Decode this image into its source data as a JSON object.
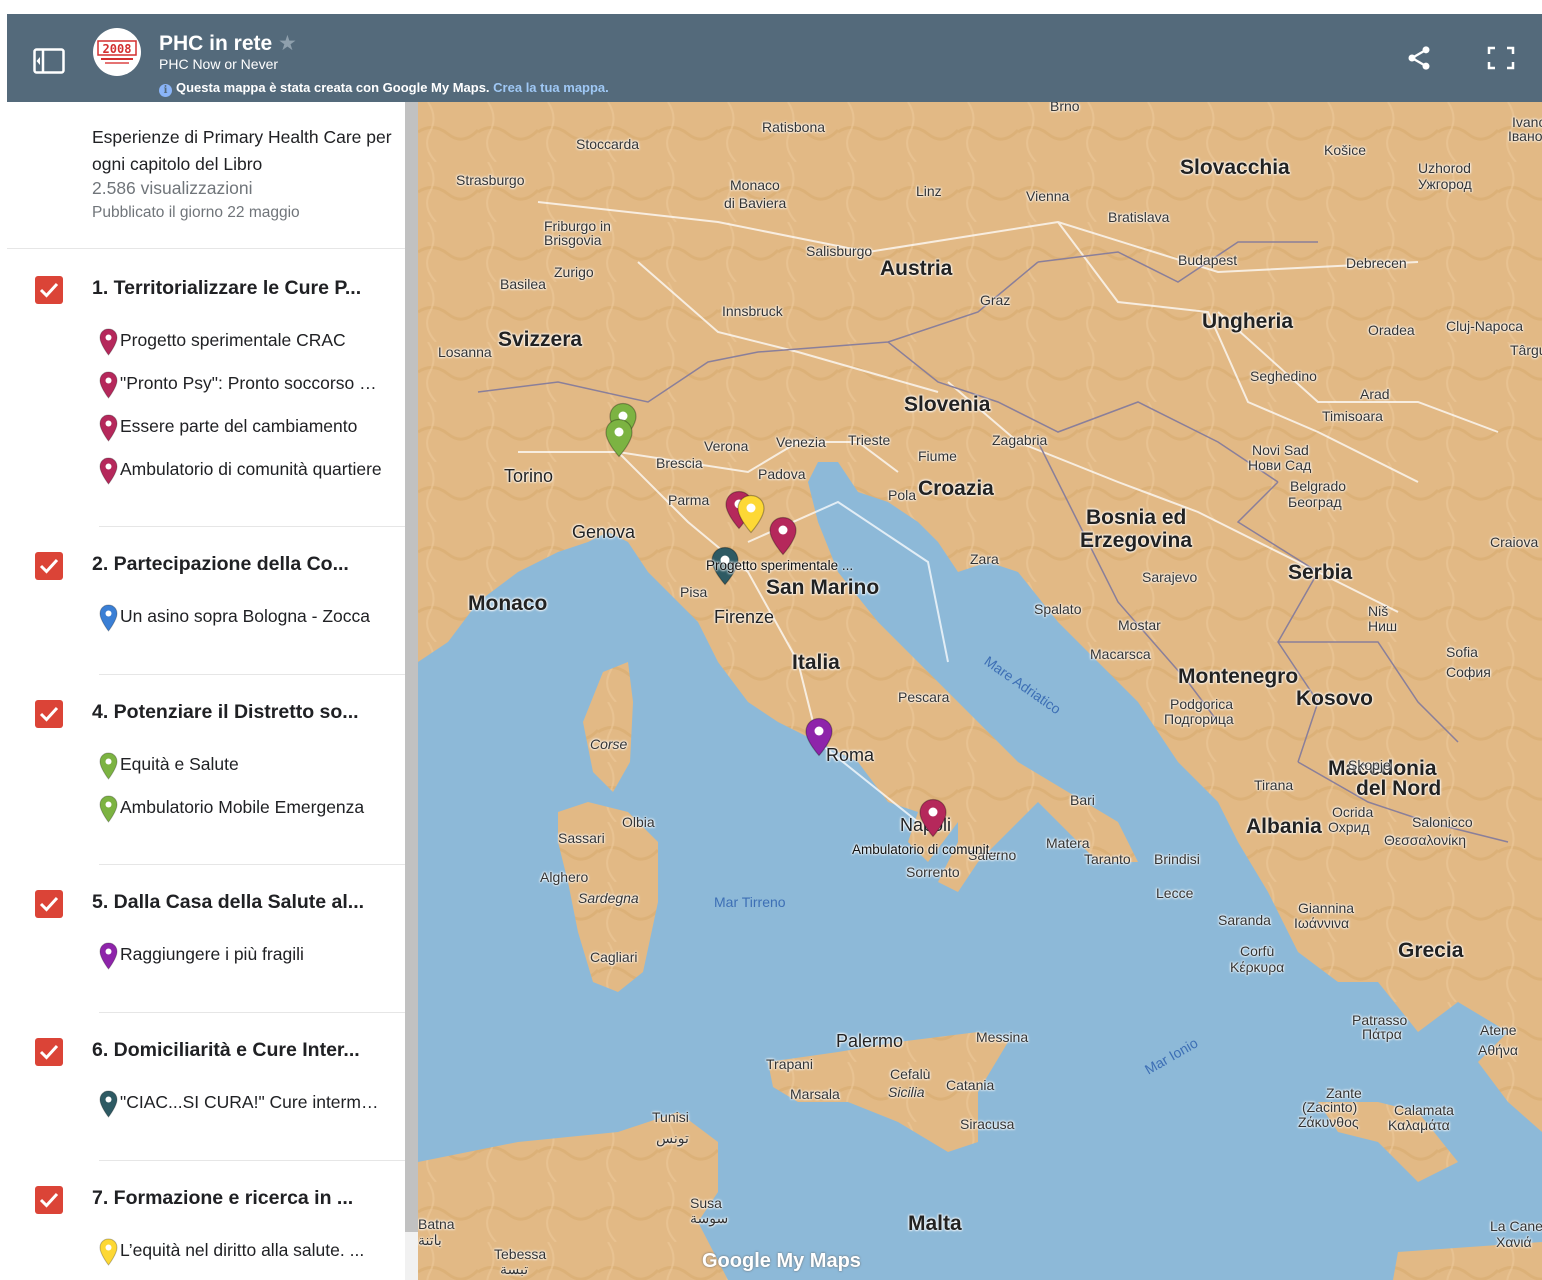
{
  "header": {
    "title": "PHC in rete",
    "subtitle": "PHC Now or Never",
    "notice_text": "Questa mappa è stata creata con Google My Maps.",
    "notice_link": "Crea la tua mappa.",
    "logo_text": "2008",
    "icons": [
      "side-panel-icon",
      "star-icon",
      "info-icon",
      "share-icon",
      "fullscreen-icon"
    ],
    "bar_color": "#546a7b"
  },
  "sidebar": {
    "description": "Esperienze di Primary Health Care per ogni capitolo del Libro",
    "views": "2.586 visualizzazioni",
    "published": "Pubblicato il giorno 22 maggio",
    "layers": [
      {
        "title": "1. Territorializzare le Cure P...",
        "checked": true,
        "places": [
          {
            "label": "Progetto sperimentale CRAC",
            "color": "#b5285b"
          },
          {
            "label": "\"Pronto Psy\": Pronto soccorso psicologico",
            "color": "#b5285b"
          },
          {
            "label": "Essere parte del cambiamento",
            "color": "#b5285b"
          },
          {
            "label": "Ambulatorio di comunità quartiere",
            "color": "#b5285b"
          }
        ]
      },
      {
        "title": "2. Partecipazione della Co...",
        "checked": true,
        "places": [
          {
            "label": "Un asino sopra Bologna - Zocca",
            "color": "#3a7fd5"
          }
        ]
      },
      {
        "title": "4. Potenziare il Distretto so...",
        "checked": true,
        "places": [
          {
            "label": "Equità e Salute",
            "color": "#7cb342"
          },
          {
            "label": "Ambulatorio Mobile Emergenza",
            "color": "#7cb342"
          }
        ]
      },
      {
        "title": "5. Dalla Casa della Salute al...",
        "checked": true,
        "places": [
          {
            "label": "Raggiungere i più fragili",
            "color": "#8e24aa"
          }
        ]
      },
      {
        "title": "6. Domiciliarità e Cure Inter...",
        "checked": true,
        "places": [
          {
            "label": "\"CIAC...SI CURA!\" Cure intermedie",
            "color": "#2e5a63"
          }
        ]
      },
      {
        "title": "7. Formazione e ricerca in ...",
        "checked": true,
        "places": [
          {
            "label": "L’equità nel diritto alla salute. ...",
            "color": "#fdd835"
          }
        ]
      }
    ]
  },
  "map": {
    "countries": [
      "Svizzera",
      "Austria",
      "Slovacchia",
      "Ungheria",
      "Slovenia",
      "Croazia",
      "Bosnia ed",
      "Erzegovina",
      "Serbia",
      "Italia",
      "San Marino",
      "Monaco",
      "Montenegro",
      "Kosovo",
      "Macedonia",
      "del Nord",
      "Albania",
      "Grecia",
      "Malta"
    ],
    "cities": [
      "Stoccarda",
      "Strasburgo",
      "Ratisbona",
      "Monaco",
      "di Baviera",
      "Linz",
      "Vienna",
      "Bratislava",
      "Brno",
      "Košice",
      "Uzhorod",
      "Ужгород",
      "Friburgo in",
      "Brisgovia",
      "Salisburgo",
      "Zurigo",
      "Basilea",
      "Budapest",
      "Debrecen",
      "Innsbruck",
      "Graz",
      "Losanna",
      "Oradea",
      "Cluj-Napoca",
      "Târgu",
      "Seghedino",
      "Arad",
      "Timisoara",
      "Verona",
      "Venezia",
      "Trieste",
      "Brescia",
      "Padova",
      "Fiume",
      "Zagabria",
      "Torino",
      "Pola",
      "Novi Sad",
      "Нови Сад",
      "Belgrado",
      "Београд",
      "Parma",
      "Genova",
      "Zara",
      "Sarajevo",
      "Craiova",
      "Pisa",
      "Firenze",
      "Spalato",
      "Mostar",
      "Niš",
      "Ниш",
      "Macarsca",
      "Sofia",
      "София",
      "Pescara",
      "Podgorica",
      "Подгорица",
      "Roma",
      "Tirana",
      "Skopje",
      "Bari",
      "Ocrida",
      "Охрид",
      "Salonicco",
      "Θεσσαλονίκη",
      "Sassari",
      "Olbia",
      "Alghero",
      "Napoli",
      "Matera",
      "Taranto",
      "Brindisi",
      "Salerno",
      "Sorrento",
      "Lecce",
      "Saranda",
      "Giannina",
      "Ιωάννινα",
      "Corfù",
      "Κέρκυρα",
      "Cagliari",
      "Palermo",
      "Messina",
      "Trapani",
      "Cefalù",
      "Marsala",
      "Catania",
      "Siracusa",
      "Patrasso",
      "Πάτρα",
      "Atene",
      "Αθήνα",
      "Zante",
      "(Zacinto)",
      "Ζάκυνθος",
      "Calamata",
      "Καλαμάτα",
      "Tunisi",
      "تونس",
      "Susa",
      "سوسة",
      "Tebessa",
      "تبسة",
      "Batna",
      "باتنة",
      "La Canea",
      "Χανιά",
      "Ivano-",
      "Івано-"
    ],
    "islands": [
      "Corse",
      "Sardegna",
      "Sicilia"
    ],
    "seas": [
      "Mar Tirreno",
      "Mare Adriatico",
      "Mar Ionio"
    ],
    "pin_labels": [
      "Progetto sperimentale ...",
      "Ambulatorio di comunit..."
    ],
    "brand": "Google My Maps",
    "land_color": "#e2b985",
    "water_color": "#8db9d8"
  }
}
